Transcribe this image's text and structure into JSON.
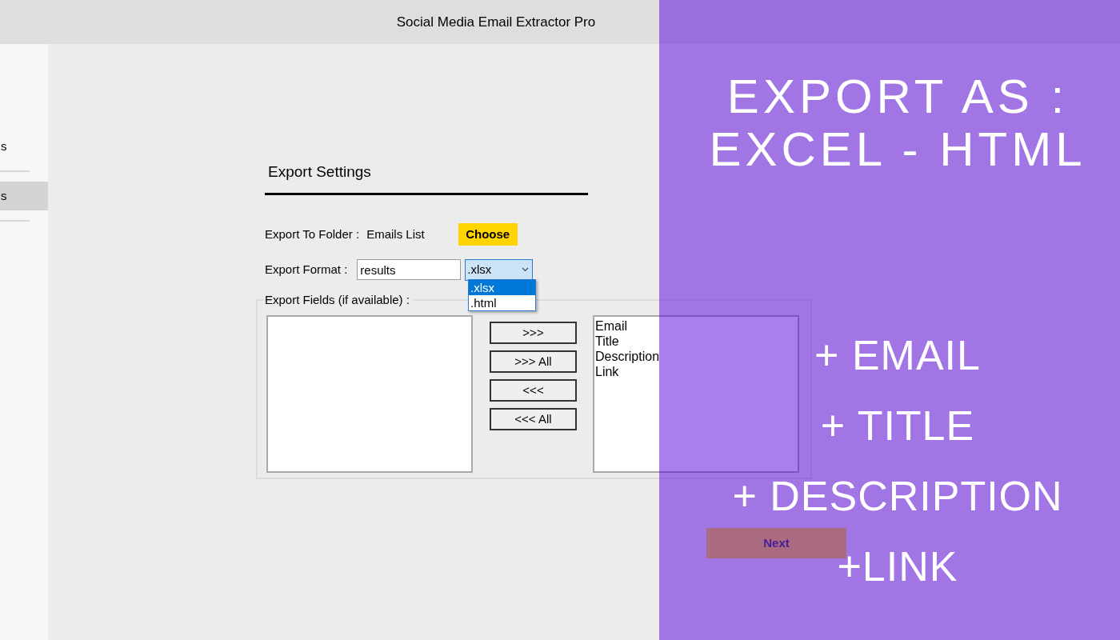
{
  "window": {
    "title": "Social Media Email Extractor Pro"
  },
  "sidebar": {
    "items": [
      {
        "label": "s",
        "selected": false
      },
      {
        "label": "s",
        "selected": true
      }
    ]
  },
  "export_settings": {
    "heading": "Export Settings",
    "folder": {
      "label": "Export To Folder :",
      "value": "Emails List",
      "button": "Choose"
    },
    "format": {
      "label": "Export Format :",
      "filename": "results",
      "selected_format": ".xlsx",
      "dropdown_open": true,
      "options": [
        {
          "label": ".xlsx",
          "selected": true
        },
        {
          "label": ".html",
          "selected": false
        }
      ]
    },
    "fields": {
      "legend": "Export Fields (if available) :",
      "buttons": [
        ">>>",
        ">>> All",
        "<<<",
        "<<< All"
      ],
      "selected_fields": [
        "Email",
        "Title",
        "Description",
        "Link"
      ]
    },
    "next_button": "Next"
  },
  "overlay": {
    "heading_lines": [
      "EXPORT AS :",
      "EXCEL - HTML"
    ],
    "items": [
      "+ EMAIL",
      "+ TITLE",
      "+ DESCRIPTION",
      "+LINK"
    ]
  }
}
